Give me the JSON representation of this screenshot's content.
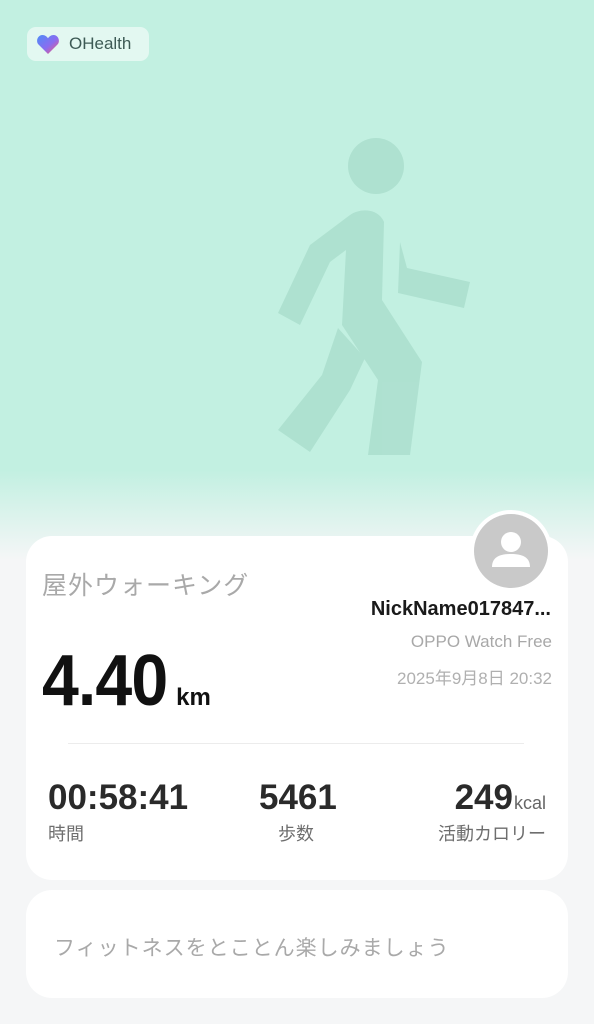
{
  "app": {
    "name": "OHealth",
    "logo_icon": "heart-icon"
  },
  "hero": {
    "illustration": "walking-person-icon",
    "bg_color": "#c2f0e1"
  },
  "workout": {
    "title": "屋外ウォーキング",
    "user_nickname": "NickName017847...",
    "device": "OPPO Watch Free",
    "datetime": "2025年9月8日 20:32",
    "distance_value": "4.40",
    "distance_unit": "km"
  },
  "stats": {
    "duration": {
      "value": "00:58:41",
      "label": "時間"
    },
    "steps": {
      "value": "5461",
      "label": "歩数"
    },
    "calories": {
      "value": "249",
      "unit": "kcal",
      "label": "活動カロリー"
    }
  },
  "motto": "フィットネスをとことん楽しみましょう"
}
